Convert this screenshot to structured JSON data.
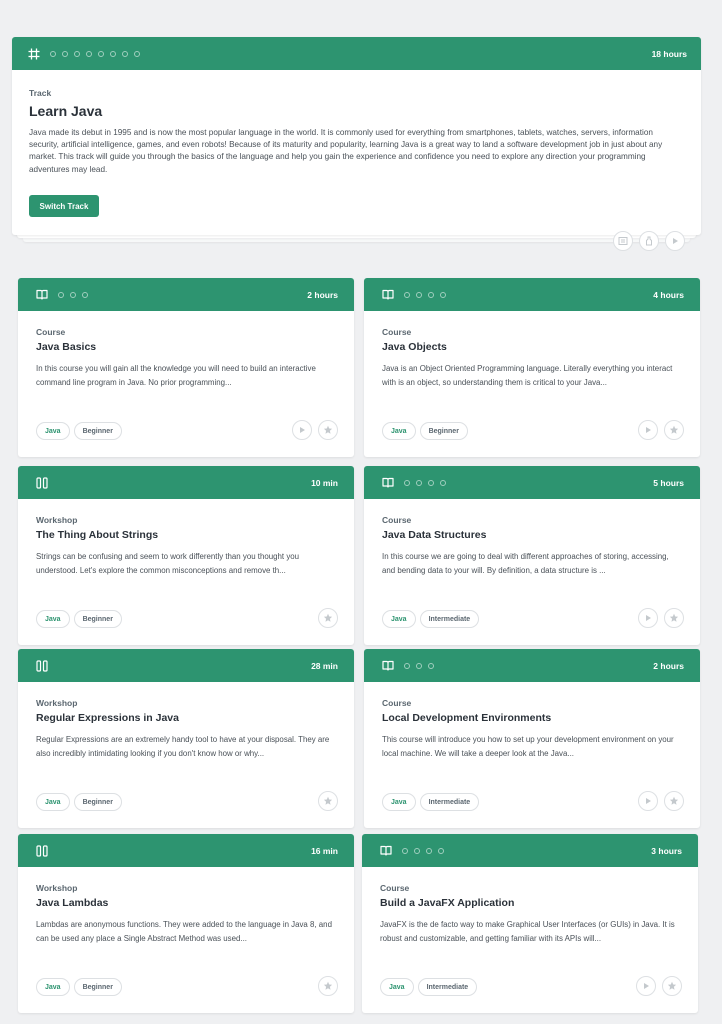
{
  "track": {
    "duration": "18 hours",
    "kind": "Track",
    "title": "Learn Java",
    "description": "Java made its debut in 1995 and is now the most popular language in the world. It is commonly used for everything from smartphones, tablets, watches, servers, information security, artificial intelligence, games, and even robots! Because of its maturity and popularity, learning Java is a great way to land a software development job in just about any market. This track will guide you through the basics of the language and help you gain the experience and confidence you need to explore any direction your programming adventures may lead.",
    "button_label": "Switch Track",
    "progress_dots": 8,
    "icons": [
      "workspace-icon",
      "bottle-icon",
      "play-icon"
    ]
  },
  "cards": [
    {
      "kind": "Course",
      "title": "Java Basics",
      "duration": "2 hours",
      "icon": "book-icon",
      "dots": 3,
      "description": "In this course you will gain all the knowledge you will need to build an interactive command line program in Java. No prior programming...",
      "tags": [
        "Java",
        "Beginner"
      ],
      "has_play": true
    },
    {
      "kind": "Course",
      "title": "Java Objects",
      "duration": "4 hours",
      "icon": "book-icon",
      "dots": 4,
      "description": "Java is an Object Oriented Programming language. Literally everything you interact with is an object, so understanding them is critical to your Java...",
      "tags": [
        "Java",
        "Beginner"
      ],
      "has_play": true
    },
    {
      "kind": "Workshop",
      "title": "The Thing About Strings",
      "duration": "10 min",
      "icon": "workshop-icon",
      "dots": 0,
      "description": "Strings can be confusing and seem to work differently than you thought you understood. Let's explore the common misconceptions and remove th...",
      "tags": [
        "Java",
        "Beginner"
      ],
      "has_play": false
    },
    {
      "kind": "Course",
      "title": "Java Data Structures",
      "duration": "5 hours",
      "icon": "book-icon",
      "dots": 4,
      "description": "In this course we are going to deal with different approaches of storing, accessing, and bending data to your will. By definition, a data structure is ...",
      "tags": [
        "Java",
        "Intermediate"
      ],
      "has_play": true
    },
    {
      "kind": "Workshop",
      "title": "Regular Expressions in Java",
      "duration": "28 min",
      "icon": "workshop-icon",
      "dots": 0,
      "description": "Regular Expressions are an extremely handy tool to have at your disposal. They are also incredibly intimidating looking if you don't know how or why...",
      "tags": [
        "Java",
        "Beginner"
      ],
      "has_play": false
    },
    {
      "kind": "Course",
      "title": "Local Development Environments",
      "duration": "2 hours",
      "icon": "book-icon",
      "dots": 3,
      "description": "This course will introduce you how to set up your development environment on your local machine. We will take a deeper look at the Java...",
      "tags": [
        "Java",
        "Intermediate"
      ],
      "has_play": true
    },
    {
      "kind": "Workshop",
      "title": "Java Lambdas",
      "duration": "16 min",
      "icon": "workshop-icon",
      "dots": 0,
      "description": "Lambdas are anonymous functions. They were added to the language in Java 8, and can be used any place a Single Abstract Method was used...",
      "tags": [
        "Java",
        "Beginner"
      ],
      "has_play": false
    },
    {
      "kind": "Course",
      "title": "Build a JavaFX Application",
      "duration": "3 hours",
      "icon": "book-icon",
      "dots": 4,
      "description": "JavaFX is the de facto way to make Graphical User Interfaces (or GUIs) in Java. It is robust and customizable, and getting familiar with its APIs will...",
      "tags": [
        "Java",
        "Intermediate"
      ],
      "has_play": true
    }
  ],
  "colors": {
    "accent": "#2d9470",
    "background": "#eff0f2"
  }
}
